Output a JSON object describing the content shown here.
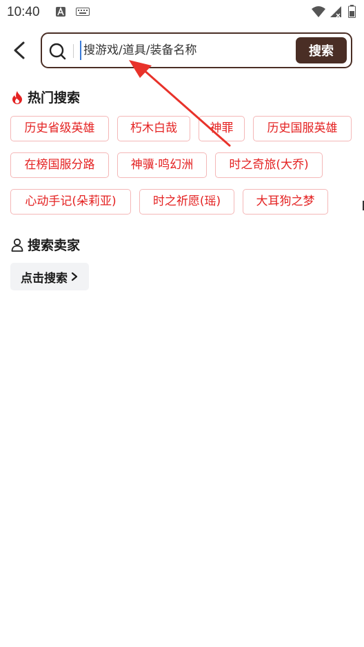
{
  "status_bar": {
    "time": "10:40",
    "left_icons": [
      "text-a-icon",
      "keyboard-icon"
    ],
    "right_icons": [
      "wifi-icon",
      "signal-icon",
      "battery-icon"
    ]
  },
  "search": {
    "placeholder": "搜游戏/道具/装备名称",
    "button_label": "搜索"
  },
  "hot_search": {
    "title": "热门搜索",
    "icon": "flame-icon",
    "tags": [
      "历史省级英雄",
      "朽木白哉",
      "神罪",
      "历史国服英雄",
      "在榜国服分路",
      "神骥·鸣幻洲",
      "时之奇旅(大乔)",
      "心动手记(朵莉亚)",
      "时之祈愿(瑶)",
      "大耳狗之梦"
    ]
  },
  "seller_search": {
    "title": "搜索卖家",
    "icon": "person-icon",
    "button_label": "点击搜索"
  },
  "colors": {
    "brand": "#4a2e25",
    "tag_text": "#e42222",
    "tag_border": "#f4b7b7",
    "annotation_arrow": "#e8322a"
  }
}
